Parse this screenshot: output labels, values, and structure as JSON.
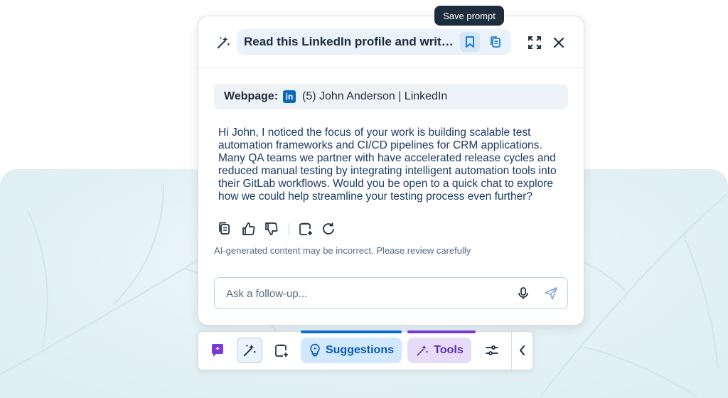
{
  "tooltip": {
    "text": "Save prompt"
  },
  "panel": {
    "title": "Read this LinkedIn profile and write an outreach message",
    "webpage": {
      "label": "Webpage:",
      "logo_text": "in",
      "page_title": "(5) John Anderson | LinkedIn"
    },
    "message": "Hi John, I noticed the focus of your work is building scalable test automation frameworks and CI/CD pipelines for CRM applications. Many QA teams we partner with have accelerated release cycles and reduced manual testing by integrating intelligent automation tools into their GitLab workflows. Would you be open to a quick chat to explore how we could help streamline your testing process even further?",
    "disclaimer": "AI-generated content may be incorrect. Please review carefully",
    "input": {
      "placeholder": "Ask a follow-up...",
      "value": ""
    },
    "icons": [
      "sparkle-icon",
      "bookmark-icon",
      "copy-icon",
      "expand-icon",
      "close-icon",
      "thumbs-up-icon",
      "thumbs-down-icon",
      "add-prompt-icon",
      "refresh-icon",
      "microphone-icon",
      "send-icon"
    ]
  },
  "toolbar": {
    "suggestions_label": "Suggestions",
    "tools_label": "Tools",
    "icons": [
      "chat-icon",
      "magic-wand-icon",
      "add-prompt-icon",
      "lightbulb-icon",
      "sparkle-wand-icon",
      "sliders-icon",
      "chevron-left-icon"
    ]
  },
  "colors": {
    "accent_blue": "#0a6ed1",
    "accent_purple": "#7a3ad8",
    "text_dark": "#1d2d3e",
    "message_text": "#1b3a66",
    "linkedin": "#0a66c2"
  }
}
